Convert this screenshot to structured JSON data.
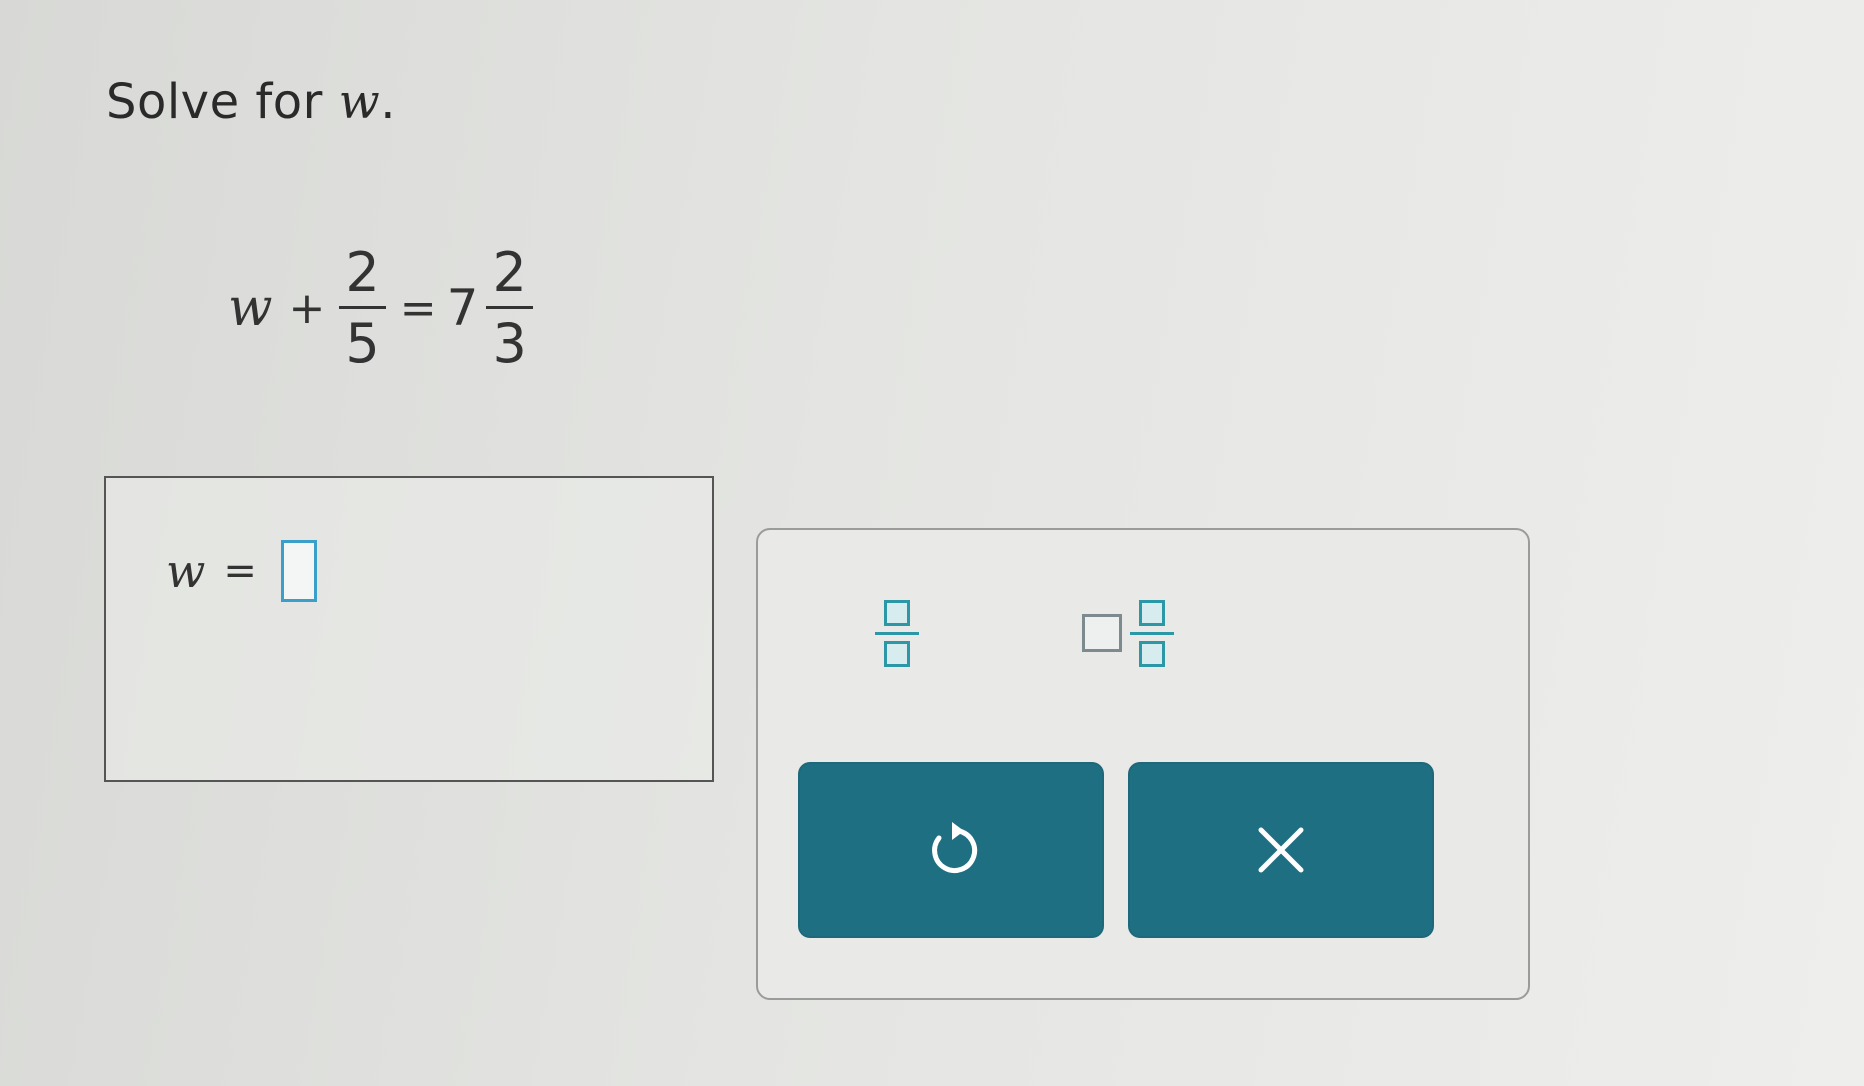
{
  "prompt": {
    "text": "Solve for ",
    "variable": "w",
    "period": "."
  },
  "equation": {
    "variable": "w",
    "plus": "+",
    "frac1": {
      "numerator": "2",
      "denominator": "5"
    },
    "equals": "=",
    "mixed": {
      "whole": "7",
      "numerator": "2",
      "denominator": "3"
    }
  },
  "answer": {
    "variable": "w",
    "equals": "=",
    "value": ""
  },
  "keypad": {
    "fraction_key": "fraction-template",
    "mixed_number_key": "mixed-number-template",
    "undo_icon": "undo-icon",
    "clear_icon": "clear-x-icon"
  },
  "colors": {
    "accent_teal": "#1f6f82",
    "template_teal": "#2c97a6",
    "input_blue": "#3aa0c9"
  }
}
